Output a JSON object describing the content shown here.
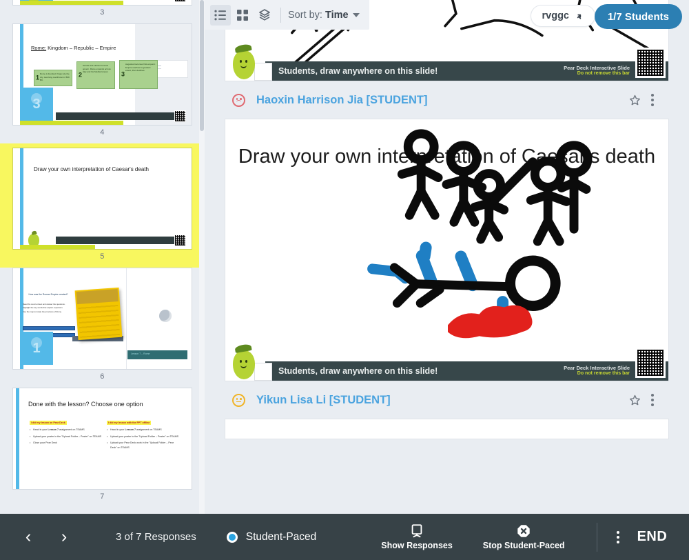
{
  "toolbar": {
    "view_list_icon": "list-view-icon",
    "view_grid_icon": "grid-view-icon",
    "view_stack_icon": "stack-view-icon",
    "sort_label": "Sort by:",
    "sort_value": "Time",
    "caret_icon": "chevron-down-icon"
  },
  "session": {
    "join_code": "rvggc",
    "expand_icon": "expand-arrow-icon",
    "students_button": "1/7 Students"
  },
  "sidebar": {
    "slides": [
      {
        "number": "3",
        "kind": "partial-top",
        "avatar_num": "",
        "title": ""
      },
      {
        "number": "4",
        "kind": "rome",
        "avatar_num": "3",
        "title_prefix": "Rome:",
        "title_rest": " Kingdom – Republic – Empire",
        "boxes": [
          {
            "num": "1",
            "text": "Rome is founded. Kings rule the city. Last king overthrown in 509 BC."
          },
          {
            "num": "2",
            "text": "Senate and elected consuls govern. Rome expands across Italy and the Mediterranean."
          },
          {
            "num": "3",
            "text": "Augustus becomes first emperor. Empire reaches its greatest extent, then declines."
          }
        ]
      },
      {
        "number": "5",
        "kind": "draw-prompt",
        "selected": true,
        "title": "Draw your own interpretation of Caesar's death"
      },
      {
        "number": "6",
        "kind": "resources",
        "avatar_num": "1",
        "heading": "How was the Roman Empire created?",
        "bullets": [
          "Read the source sheet and answer the questions.",
          "Highlight the key words that explain expansion.",
          "Use the map to locate the provinces of Rome."
        ],
        "buttons": [
          "Open the worksheet",
          "Watch the short video"
        ],
        "teal_label": "Lesson 7 – Rome"
      },
      {
        "number": "7",
        "kind": "wrapup",
        "title": "Done with the lesson? Choose one option",
        "col_a_head": "I did my lesson on Pear Deck",
        "col_a_items": [
          "Hand in your <b>Lesson 7</b> assignment on TEAMS",
          "Upload your poster in the \"Upload Folder – Poster\" on TEAMS",
          "Close your Pear Deck"
        ],
        "col_b_head": "I did my lesson with the PPT offline",
        "col_b_items": [
          "Hand in your <b>Lesson 7</b> assignment on TEAMS",
          "Upload your poster in the \"Upload Folder – Poster\" on TEAMS",
          "Upload your Pear Deck work in the \"Upload Folder – Pear Deck\" on TEAMS"
        ]
      }
    ]
  },
  "deckbar": {
    "prompt": "Students, draw anywhere on this slide!",
    "brand_line1": "Pear Deck Interactive Slide",
    "brand_line2": "Do not remove this bar",
    "qr_icon": "qr-code-icon",
    "pear_icon": "pear-mascot-icon"
  },
  "responses": [
    {
      "student": "Haoxin Harrison Jia [STUDENT]",
      "mood_icon": "sad-face-icon",
      "mood_color": "#e06b72",
      "star_icon": "star-outline-icon",
      "menu_icon": "kebab-menu-icon",
      "title": ""
    },
    {
      "student": "Yikun Lisa Li [STUDENT]",
      "mood_icon": "neutral-face-icon",
      "mood_color": "#f0b429",
      "star_icon": "star-outline-icon",
      "menu_icon": "kebab-menu-icon",
      "title": "Draw your own interpretation of Caesar's death"
    }
  ],
  "bottom_bar": {
    "prev_icon": "chevron-left-icon",
    "next_icon": "chevron-right-icon",
    "response_count": "3 of 7 Responses",
    "pace_mode": "Student-Paced",
    "pace_dot_color": "#2aa3e0",
    "show_responses_label": "Show Responses",
    "show_responses_icon": "projector-screen-icon",
    "stop_paced_label": "Stop Student-Paced",
    "stop_paced_icon": "octagon-x-icon",
    "menu_icon": "kebab-menu-icon",
    "end_label": "END"
  },
  "colors": {
    "accent_blue": "#2c7fb3",
    "link_blue": "#4aa3df",
    "selected_yellow": "#f8f75f",
    "bar_dark": "#374247",
    "pear_green": "#b5d334"
  }
}
